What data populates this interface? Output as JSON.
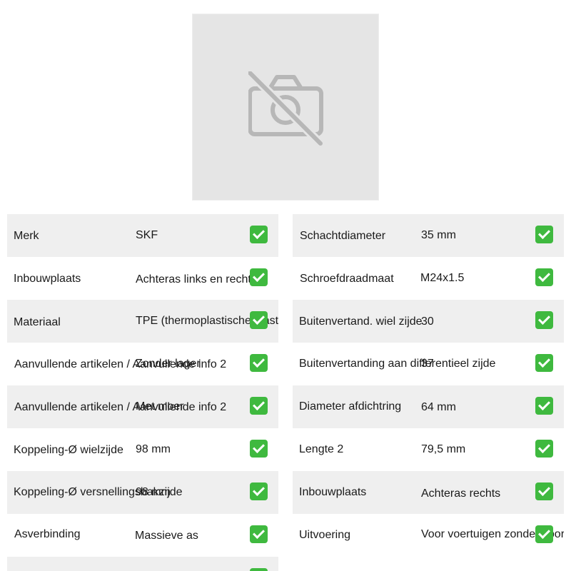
{
  "product_image": {
    "icon": "no-photo-icon",
    "background": "#e5e5e5"
  },
  "colors": {
    "row_shaded": "#efefef",
    "check_green": "#3fb93f"
  },
  "specs_left": [
    {
      "label": "Merk",
      "value": "SKF",
      "status_icon": "check-icon"
    },
    {
      "label": "Inbouwplaats",
      "value": "Achteras links en rechts",
      "status_icon": "check-icon"
    },
    {
      "label": "Materiaal",
      "value": "TPE (thermoplastische elastomeer)",
      "status_icon": "check-icon"
    },
    {
      "label": "Aanvullende artikelen / Aanvullende info 2",
      "value": "Zonder lager",
      "status_icon": "check-icon"
    },
    {
      "label": "Aanvullende artikelen / Aanvullende info 2",
      "value": "Met moer",
      "status_icon": "check-icon"
    },
    {
      "label": "Koppeling-Ø wielzijde",
      "value": "98 mm",
      "status_icon": "check-icon"
    },
    {
      "label": "Koppeling-Ø versnellingsbakzijde",
      "value": "98 mm",
      "status_icon": "check-icon"
    },
    {
      "label": "Asverbinding",
      "value": "Massieve as",
      "status_icon": "check-icon"
    },
    {
      "label": "",
      "value": "",
      "status_icon": "check-icon"
    }
  ],
  "specs_right": [
    {
      "label": "Schachtdiameter",
      "value": "35 mm",
      "status_icon": "check-icon"
    },
    {
      "label": "Schroefdraadmaat",
      "value": "M24x1.5",
      "status_icon": "check-icon"
    },
    {
      "label": "Buitenvertand. wiel zijde",
      "value": "30",
      "status_icon": "check-icon"
    },
    {
      "label": "Buitenvertanding aan differentieel zijde",
      "value": "37",
      "status_icon": "check-icon"
    },
    {
      "label": "Diameter afdichtring",
      "value": "64 mm",
      "status_icon": "check-icon"
    },
    {
      "label": "Lengte 2",
      "value": "79,5 mm",
      "status_icon": "check-icon"
    },
    {
      "label": "Inbouwplaats",
      "value": "Achteras rechts",
      "status_icon": "check-icon"
    },
    {
      "label": "Uitvoering",
      "value": "Voor voertuigen zonder sportonderstel",
      "status_icon": "check-icon"
    }
  ]
}
